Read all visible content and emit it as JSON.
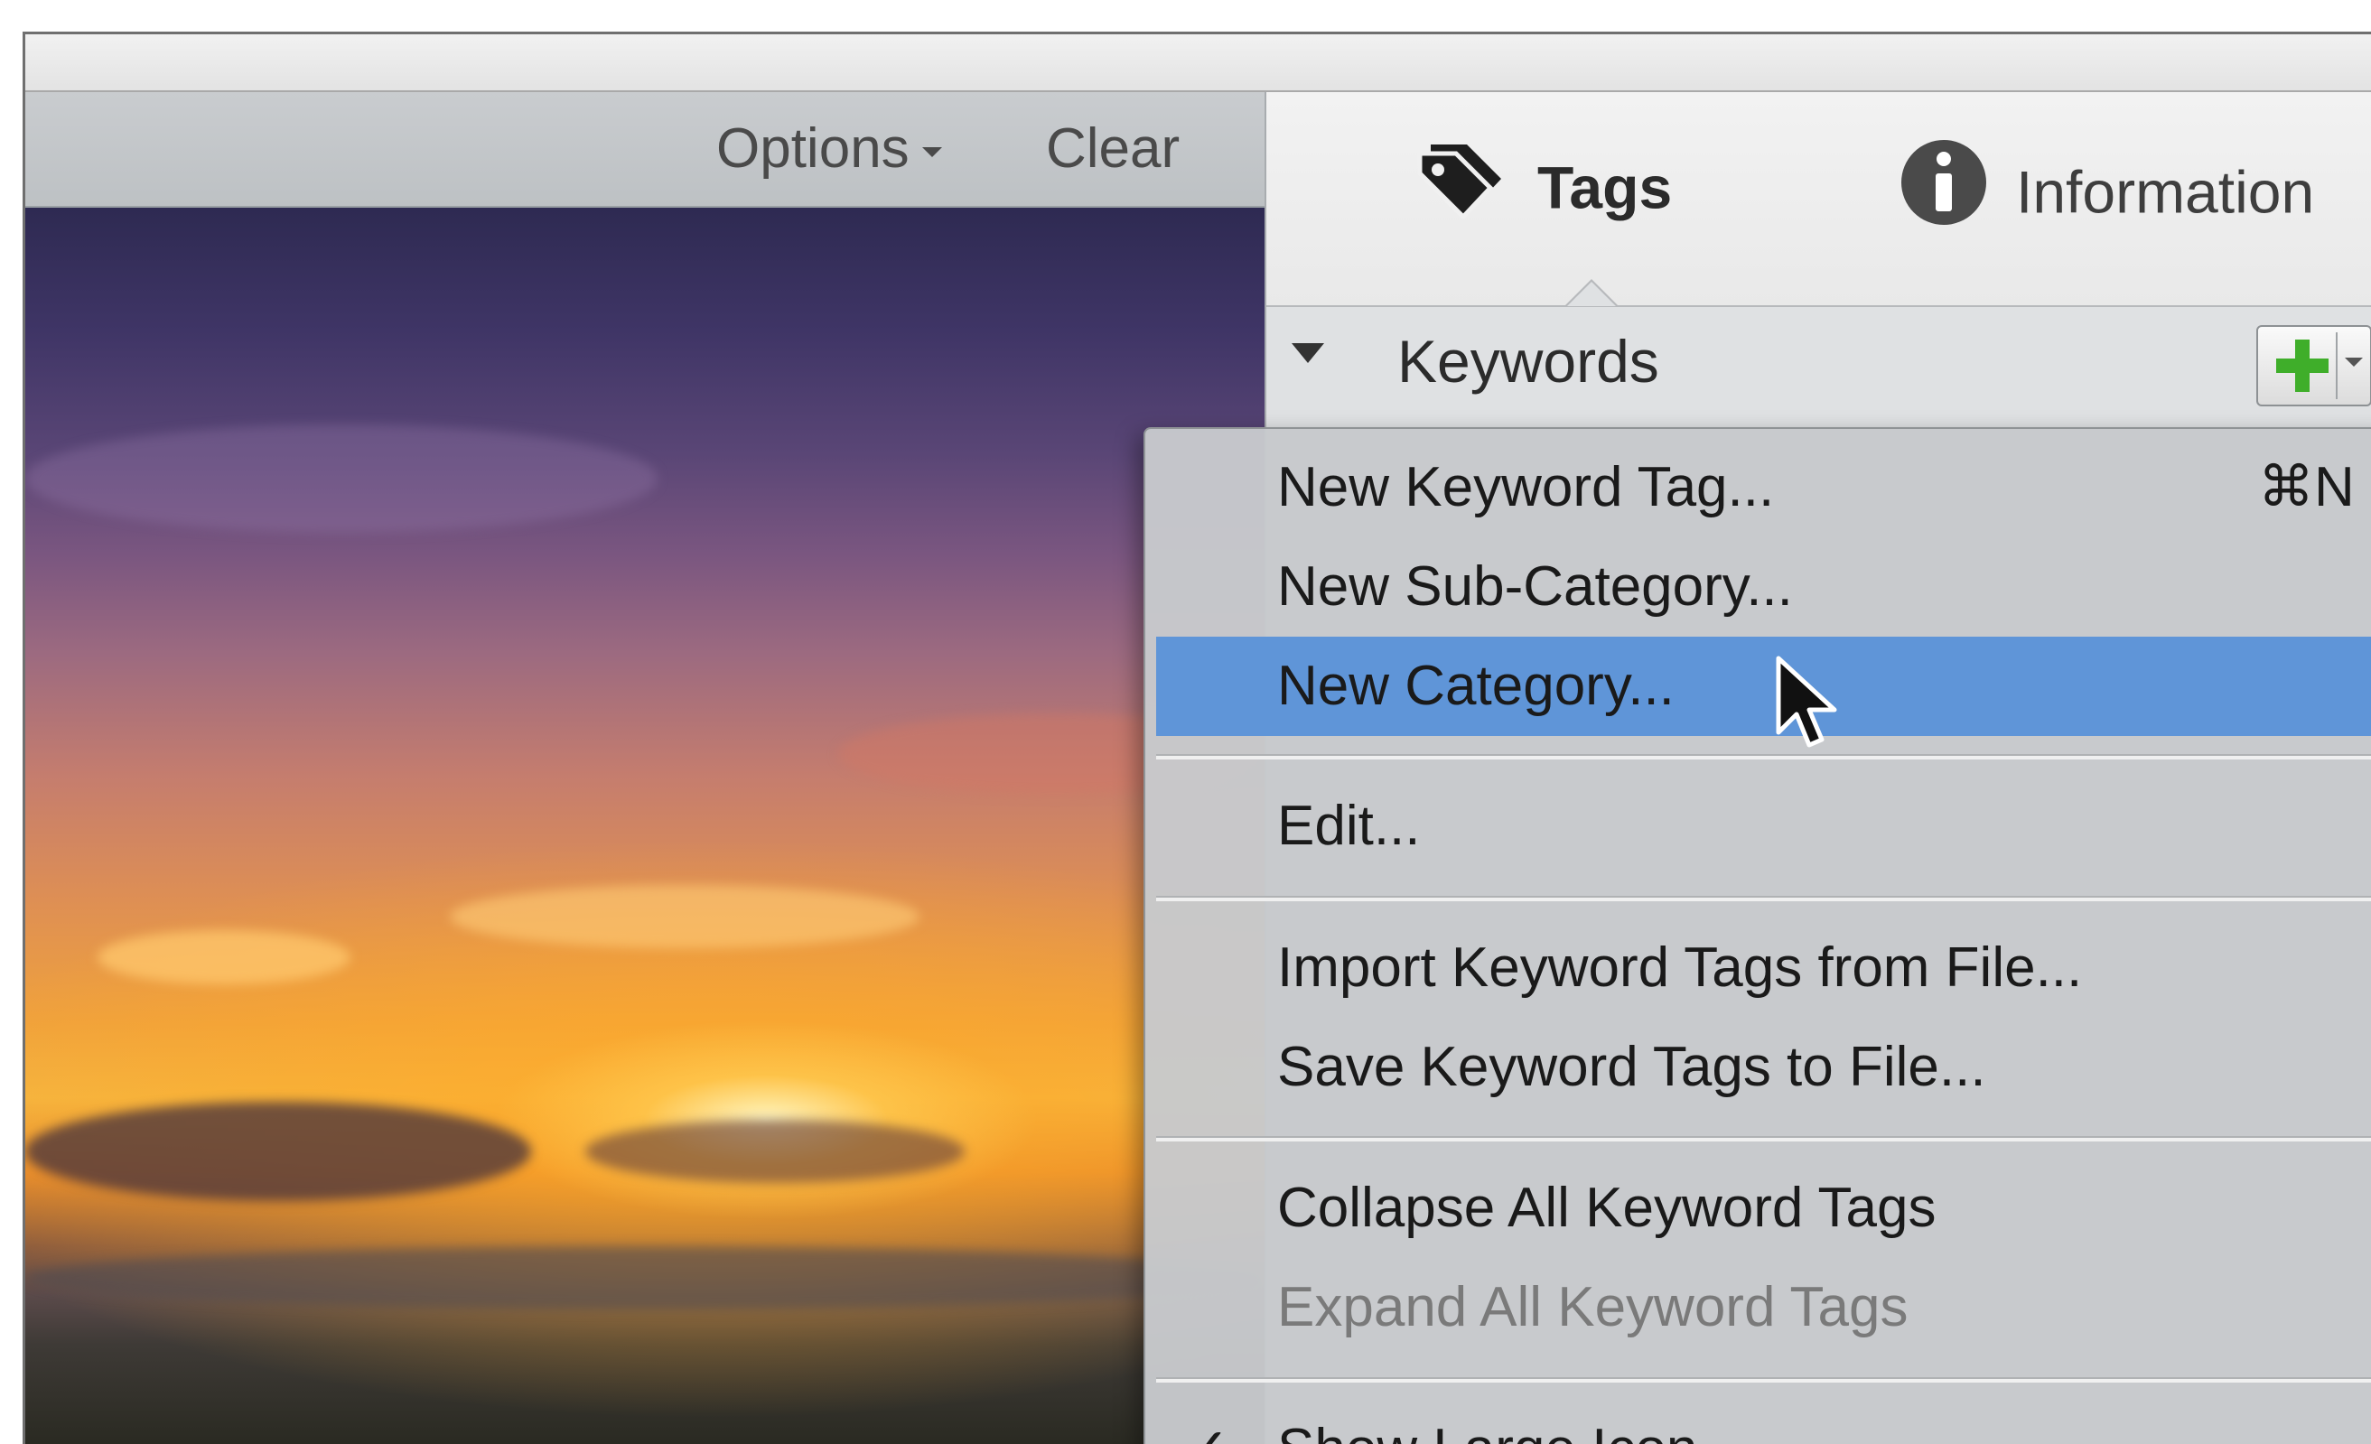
{
  "toolbar": {
    "options_label": "Options",
    "clear_label": "Clear"
  },
  "panel": {
    "tabs": [
      {
        "label": "Tags",
        "icon": "tag-icon",
        "active": true
      },
      {
        "label": "Information",
        "icon": "info-icon",
        "active": false
      }
    ],
    "keywords": {
      "label": "Keywords",
      "add_button_icon": "plus-icon"
    }
  },
  "menu": {
    "items": [
      {
        "label": "New Keyword Tag...",
        "shortcut": "⌘N"
      },
      {
        "label": "New Sub-Category..."
      },
      {
        "label": "New Category...",
        "highlighted": true
      },
      {
        "label": "Edit..."
      },
      {
        "label": "Import Keyword Tags from File..."
      },
      {
        "label": "Save Keyword Tags to File..."
      },
      {
        "label": "Collapse All Keyword Tags"
      },
      {
        "label": "Expand All Keyword Tags",
        "disabled": true
      },
      {
        "label": "Show Large Icon",
        "checked": true,
        "check_glyph": "✓"
      }
    ]
  },
  "colors": {
    "highlight": "#5f95d8",
    "plus_green": "#3fae2a"
  }
}
